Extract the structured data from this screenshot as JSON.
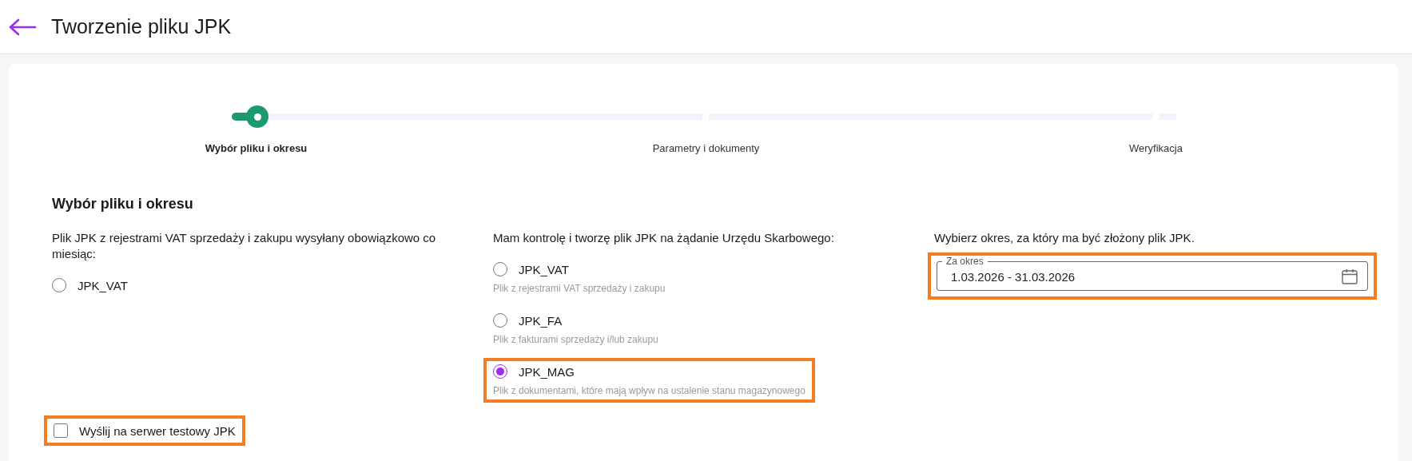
{
  "header": {
    "title": "Tworzenie pliku JPK"
  },
  "stepper": {
    "steps": [
      {
        "label": "Wybór pliku i okresu",
        "selected": true
      },
      {
        "label": "Parametry i dokumenty",
        "selected": false
      },
      {
        "label": "Weryfikacja",
        "selected": false
      }
    ]
  },
  "section": {
    "title": "Wybór pliku i okresu"
  },
  "columns": [
    {
      "intro": "Plik JPK z rejestrami VAT sprzedaży i zakupu wysyłany obowiązkowo co miesiąc:",
      "options": [
        {
          "label": "JPK_VAT",
          "selected": false,
          "highlighted": false
        }
      ]
    },
    {
      "intro": "Mam kontrolę i tworzę plik JPK na żądanie Urzędu Skarbowego:",
      "options": [
        {
          "label": "JPK_VAT",
          "description": "Plik z rejestrami VAT sprzedaży i zakupu",
          "selected": false,
          "highlighted": false
        },
        {
          "label": "JPK_FA",
          "description": "Plik z fakturami sprzedaży i/lub zakupu",
          "selected": false,
          "highlighted": false
        },
        {
          "label": "JPK_MAG",
          "description": "Plik z dokumentami, które mają wpływ na ustalenie stanu magazynowego",
          "selected": true,
          "highlighted": true
        }
      ]
    }
  ],
  "period": {
    "intro": "Wybierz okres, za który ma być złożony plik JPK.",
    "field": {
      "label": "Za okres",
      "value": "1.03.2026 - 31.03.2026",
      "highlighted": true
    }
  },
  "test_server": {
    "label": "Wyślij na serwer testowy JPK",
    "checked": false,
    "highlighted": true
  }
}
